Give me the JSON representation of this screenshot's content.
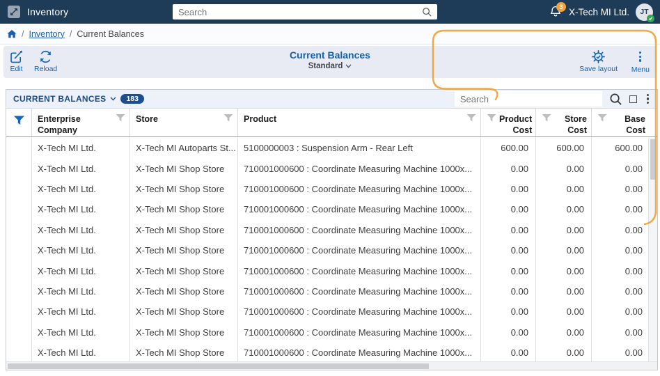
{
  "app": {
    "title": "Inventory",
    "search_placeholder": "Search",
    "notification_count": "3",
    "company": "X-Tech MI Ltd.",
    "avatar_initials": "JT"
  },
  "breadcrumb": {
    "separator": "/",
    "items": [
      "Inventory",
      "Current Balances"
    ]
  },
  "toolbar": {
    "edit_label": "Edit",
    "reload_label": "Reload",
    "title": "Current Balances",
    "view_label": "Standard",
    "save_layout_label": "Save layout",
    "menu_label": "Menu"
  },
  "grid": {
    "title": "CURRENT BALANCES",
    "count": "183",
    "search_placeholder": "Search",
    "columns": {
      "company": "Enterprise Company",
      "store": "Store",
      "product": "Product",
      "product_cost": "Product Cost",
      "store_cost": "Store Cost",
      "base_cost": "Base Cost"
    },
    "rows": [
      {
        "company": "X-Tech MI Ltd.",
        "store": "X-Tech MI Autoparts St...",
        "product": "5100000003 : Suspension Arm - Rear Left",
        "product_cost": "600.00",
        "store_cost": "600.00",
        "base_cost": "600.00"
      },
      {
        "company": "X-Tech MI Ltd.",
        "store": "X-Tech MI Shop Store",
        "product": "710001000600 : Coordinate Measuring Machine 1000x...",
        "product_cost": "0.00",
        "store_cost": "0.00",
        "base_cost": "0.00"
      },
      {
        "company": "X-Tech MI Ltd.",
        "store": "X-Tech MI Shop Store",
        "product": "710001000600 : Coordinate Measuring Machine 1000x...",
        "product_cost": "0.00",
        "store_cost": "0.00",
        "base_cost": "0.00"
      },
      {
        "company": "X-Tech MI Ltd.",
        "store": "X-Tech MI Shop Store",
        "product": "710001000600 : Coordinate Measuring Machine 1000x...",
        "product_cost": "0.00",
        "store_cost": "0.00",
        "base_cost": "0.00"
      },
      {
        "company": "X-Tech MI Ltd.",
        "store": "X-Tech MI Shop Store",
        "product": "710001000600 : Coordinate Measuring Machine 1000x...",
        "product_cost": "0.00",
        "store_cost": "0.00",
        "base_cost": "0.00"
      },
      {
        "company": "X-Tech MI Ltd.",
        "store": "X-Tech MI Shop Store",
        "product": "710001000600 : Coordinate Measuring Machine 1000x...",
        "product_cost": "0.00",
        "store_cost": "0.00",
        "base_cost": "0.00"
      },
      {
        "company": "X-Tech MI Ltd.",
        "store": "X-Tech MI Shop Store",
        "product": "710001000600 : Coordinate Measuring Machine 1000x...",
        "product_cost": "0.00",
        "store_cost": "0.00",
        "base_cost": "0.00"
      },
      {
        "company": "X-Tech MI Ltd.",
        "store": "X-Tech MI Shop Store",
        "product": "710001000600 : Coordinate Measuring Machine 1000x...",
        "product_cost": "0.00",
        "store_cost": "0.00",
        "base_cost": "0.00"
      },
      {
        "company": "X-Tech MI Ltd.",
        "store": "X-Tech MI Shop Store",
        "product": "710001000600 : Coordinate Measuring Machine 1000x...",
        "product_cost": "0.00",
        "store_cost": "0.00",
        "base_cost": "0.00"
      },
      {
        "company": "X-Tech MI Ltd.",
        "store": "X-Tech MI Shop Store",
        "product": "710001000600 : Coordinate Measuring Machine 1000x...",
        "product_cost": "0.00",
        "store_cost": "0.00",
        "base_cost": "0.00"
      },
      {
        "company": "X-Tech MI Ltd.",
        "store": "X-Tech MI Shop Store",
        "product": "710001000600 : Coordinate Measuring Machine 1000x...",
        "product_cost": "0.00",
        "store_cost": "0.00",
        "base_cost": "0.00"
      }
    ]
  },
  "colors": {
    "topbar_navy": "#1e3c58",
    "accent_blue": "#1364b0",
    "title_blue": "#0d62b0",
    "badge_navy": "#1d4e8f",
    "notification_orange": "#f2a33c",
    "status_green": "#33a852",
    "annotation_orange": "#f0a43c"
  }
}
